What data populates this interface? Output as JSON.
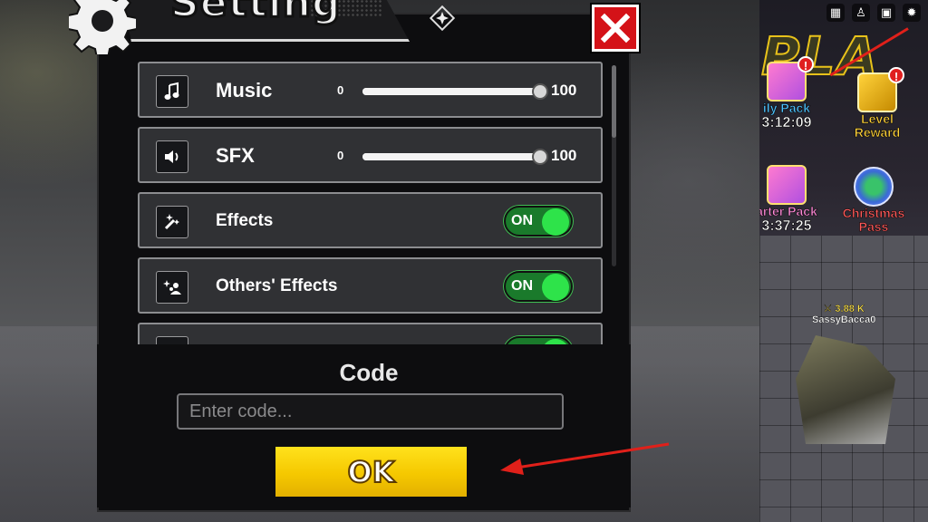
{
  "settings": {
    "title": "Setting",
    "rows": [
      {
        "label": "Music",
        "type": "slider",
        "min": "0",
        "max": "100",
        "value": 100
      },
      {
        "label": "SFX",
        "type": "slider",
        "min": "0",
        "max": "100",
        "value": 100
      },
      {
        "label": "Effects",
        "type": "toggle",
        "state": "ON"
      },
      {
        "label": "Others' Effects",
        "type": "toggle",
        "state": "ON"
      },
      {
        "label": "",
        "type": "toggle",
        "state": "ON"
      }
    ]
  },
  "code": {
    "title": "Code",
    "placeholder": "Enter code...",
    "ok_label": "OK"
  },
  "game_hud": {
    "promos": [
      {
        "label": "ily Pack",
        "timer": "3:12:09"
      },
      {
        "label": "Level Reward",
        "timer": ""
      },
      {
        "label": "arter Pack",
        "timer": "3:37:25"
      },
      {
        "label": "Christmas Pass",
        "timer": ""
      }
    ],
    "player": {
      "power": "3.88 K",
      "name": "SassyBacca0"
    },
    "sign_text": "PLA"
  },
  "colors": {
    "accent_red": "#d41218",
    "ok_yellow": "#f5c800",
    "toggle_green": "#2ee34a"
  }
}
